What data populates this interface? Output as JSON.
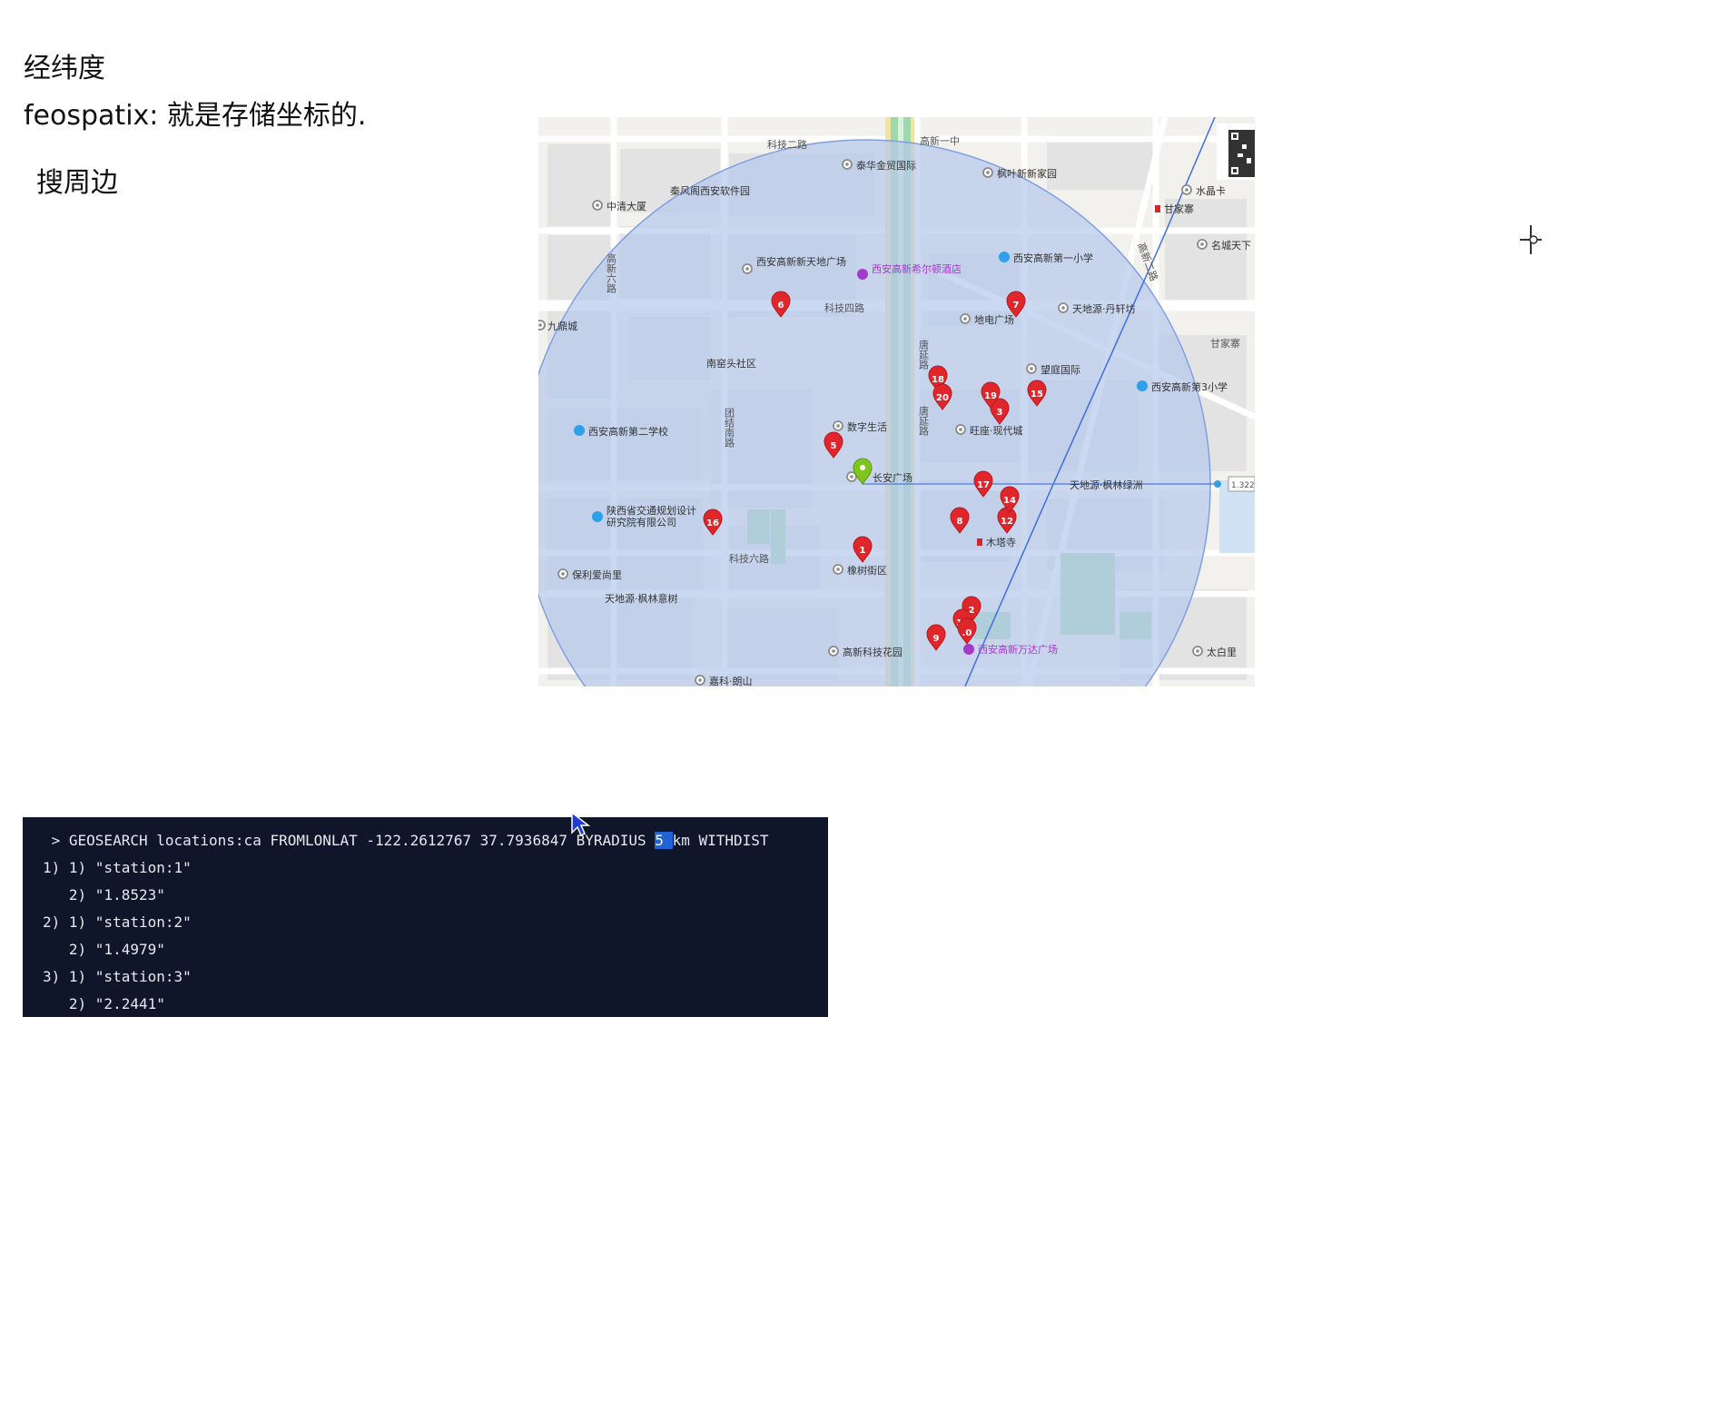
{
  "notes": {
    "title": "经纬度",
    "desc": "feospatix: 就是存储坐标的.",
    "subtitle": "搜周边"
  },
  "map": {
    "circle_color": "#b7c9ec",
    "streets": {
      "keji2": "科技二路",
      "keji4": "科技四路",
      "keji6": "科技六路",
      "gaoxin1": "高新一中",
      "gaoxin6": "高新六路",
      "tuanjie": "团结南路",
      "tangyan1": "唐延路",
      "tangyan2": "唐延路",
      "line_right": "高新二路",
      "gaojia": "甘家寨"
    },
    "pois": {
      "taihua": "泰华金贸国际",
      "fengye": "枫叶新新家园",
      "shuijing": "水晶卡",
      "ganjiazhai1": "甘家寨",
      "mingcheng": "名城天下",
      "zhongqing": "中清大厦",
      "qinfeng": "秦风阁西安软件园",
      "xinTiandi": "西安高新新天地广场",
      "xier": "西安高新希尔顿酒店",
      "diyi": "西安高新第一小学",
      "jiuding": "九鼎城",
      "dongdian": "地电广场",
      "danxuan": "天地源·丹轩坊",
      "ganjiazhai2": "甘家寨",
      "nanyao": "南窑头社区",
      "wangting": "望庭国际",
      "disan": "西安高新第3小学",
      "dier": "西安高新第二学校",
      "shuzi": "数字生活",
      "wangzuo": "旺座·现代城",
      "changan": "长安广场",
      "fenglin": "天地源·枫林绿洲",
      "scale": "1.322",
      "jiaotong1": "陕西省交通规划设计",
      "jiaotong2": "研究院有限公司",
      "muta": "木塔寺",
      "baoli": "保利爱尚里",
      "tongshu": "橡树街区",
      "fenglinyishu": "天地源·枫林意树",
      "keji_garden": "高新科技花园",
      "wanda": "西安高新万达广场",
      "taibaili": "太白里",
      "jiashan": "嘉科·朗山"
    },
    "markers": [
      "1",
      "2",
      "3",
      "5",
      "6",
      "7",
      "8",
      "9",
      "12",
      "13",
      "14",
      "15",
      "16",
      "17",
      "18",
      "19",
      "20",
      ".0"
    ]
  },
  "terminal": {
    "command_prefix": " > GEOSEARCH locations:ca FROMLONLAT -122.2612767 37.7936847 BYRADIUS ",
    "command_highlight": "5 ",
    "command_suffix": "km WITHDIST",
    "lines": [
      "1) 1) \"station:1\"",
      "   2) \"1.8523\"",
      "2) 1) \"station:2\"",
      "   2) \"1.4979\"",
      "3) 1) \"station:3\"",
      "   2) \"2.2441\""
    ]
  }
}
